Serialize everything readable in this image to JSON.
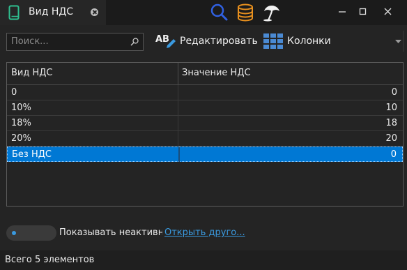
{
  "window": {
    "tab_title": "Вид НДС",
    "colors": {
      "accent": "#0078d4",
      "link": "#3a9ae0",
      "tab_icon": "#2fbf8f",
      "search_tool": "#3060e0",
      "database_tool": "#e8901e"
    }
  },
  "titlebar_icons": [
    "search-icon",
    "database-icon",
    "palm-tree-icon"
  ],
  "toolbar": {
    "search_placeholder": "Поиск...",
    "edit_label": "Редактировать",
    "columns_label": "Колонки"
  },
  "grid": {
    "columns": [
      "Вид НДС",
      "Значение НДС"
    ],
    "rows": [
      {
        "name": "0",
        "value": "0",
        "selected": false
      },
      {
        "name": "10%",
        "value": "10",
        "selected": false
      },
      {
        "name": "18%",
        "value": "18",
        "selected": false
      },
      {
        "name": "20%",
        "value": "20",
        "selected": false
      },
      {
        "name": "Без НДС",
        "value": "0",
        "selected": true
      }
    ]
  },
  "footer": {
    "show_inactive_label": "Показывать неактивные",
    "open_other_link": "Открыть друго...",
    "status": "Всего 5 элементов"
  }
}
